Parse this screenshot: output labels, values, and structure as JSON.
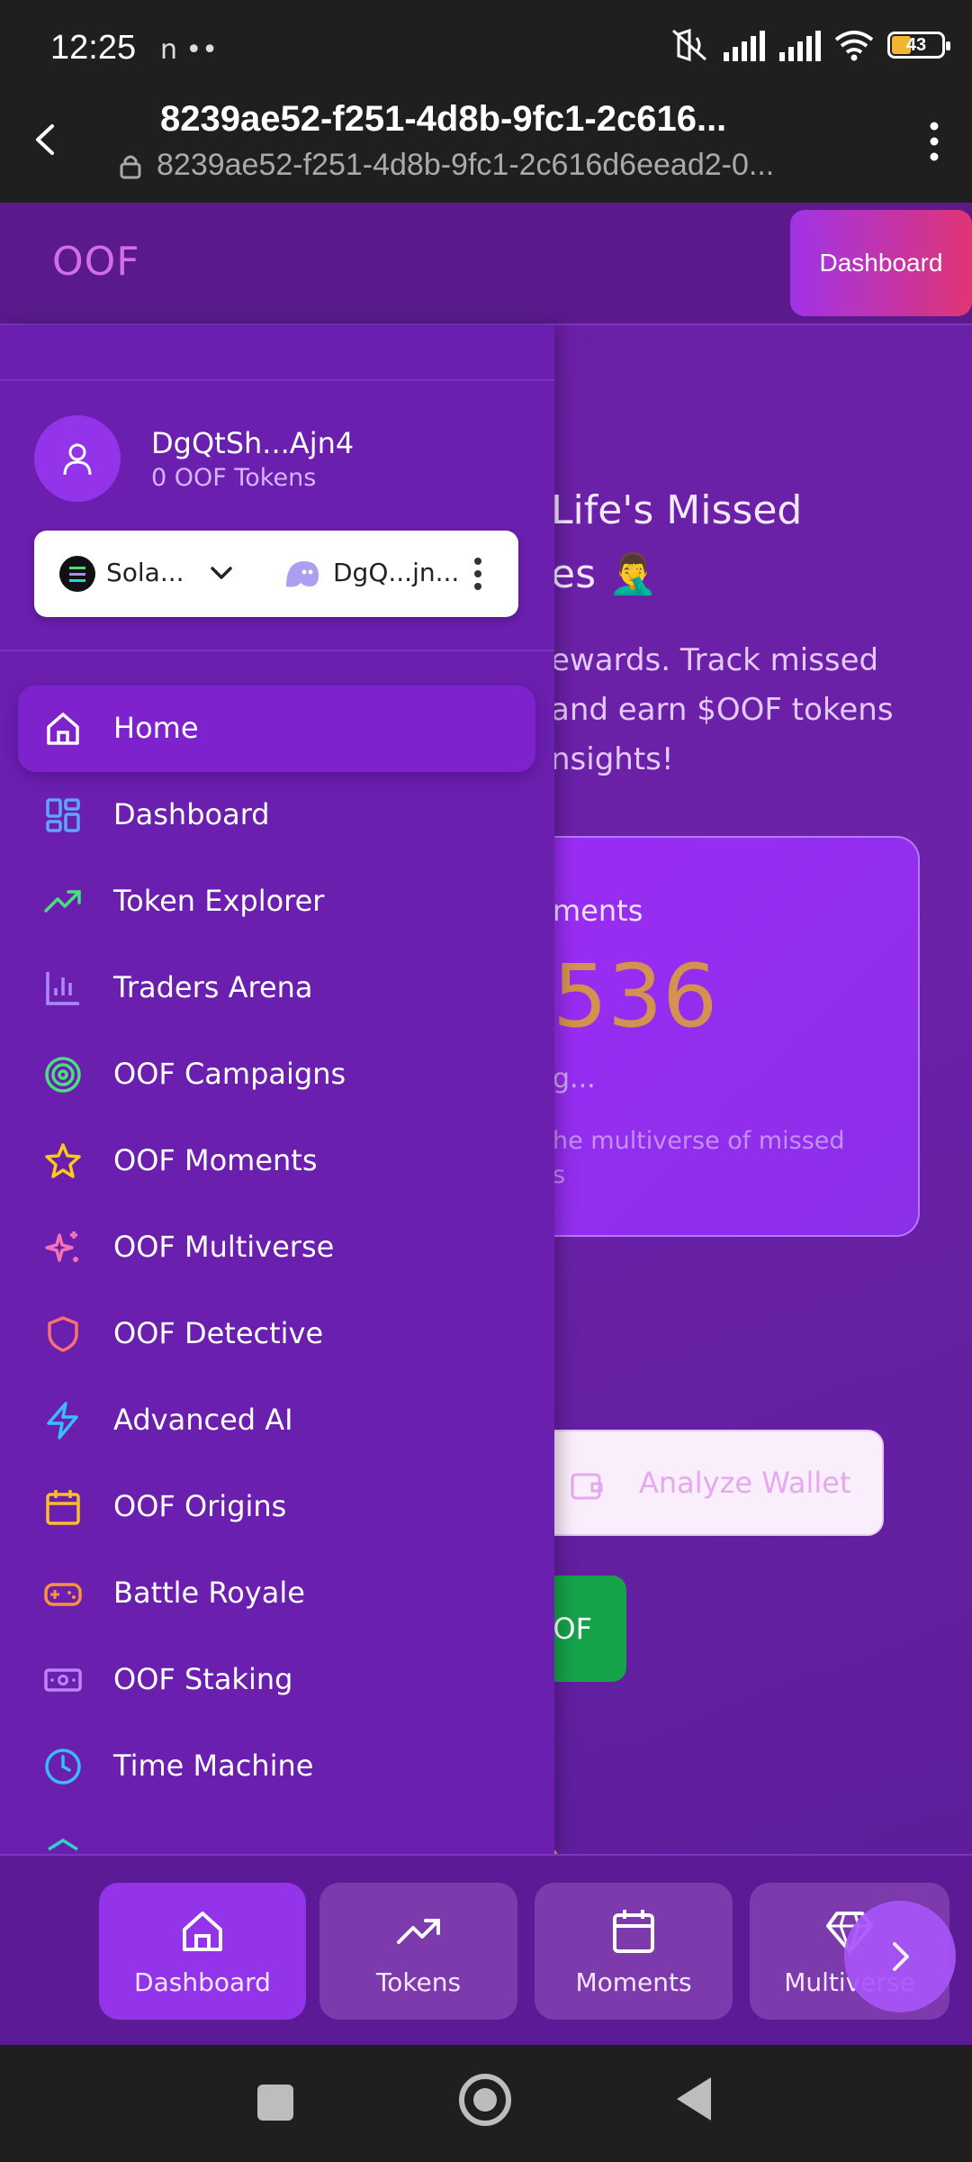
{
  "status_bar": {
    "time": "12:25",
    "notification_icons": "n ••",
    "battery": "43"
  },
  "browser": {
    "title": "8239ae52-f251-4d8b-9fc1-2c616...",
    "url": "8239ae52-f251-4d8b-9fc1-2c616d6eead2-0..."
  },
  "topbar": {
    "logo": "OOF",
    "dashboard_button": "Dashboard"
  },
  "main": {
    "hero_line1": "Life's Missed",
    "hero_line2": "es 🤦‍♂️",
    "hero_sub": [
      "ewards. Track missed",
      "and earn $OOF tokens",
      "nsights!"
    ],
    "stat_label": "ments",
    "stat_value": "536",
    "stat_loading": "g...",
    "stat_desc": [
      "he multiverse of missed",
      "s"
    ],
    "analyze_button": "Analyze Wallet",
    "green_button": "OF"
  },
  "drawer": {
    "user_name": "DgQtSh...Ajn4",
    "user_tokens": "0 OOF Tokens",
    "network": "Sola...",
    "wallet_address": "DgQ...jn...",
    "items": [
      {
        "label": "Home",
        "icon": "home-icon",
        "color": "#ffffff"
      },
      {
        "label": "Dashboard",
        "icon": "grid-icon",
        "color": "#60a5fa"
      },
      {
        "label": "Token Explorer",
        "icon": "trending-up-icon",
        "color": "#4ade80"
      },
      {
        "label": "Traders Arena",
        "icon": "bar-chart-icon",
        "color": "#a78bfa"
      },
      {
        "label": "OOF Campaigns",
        "icon": "target-icon",
        "color": "#4ade80"
      },
      {
        "label": "OOF Moments",
        "icon": "star-icon",
        "color": "#facc15"
      },
      {
        "label": "OOF Multiverse",
        "icon": "sparkles-icon",
        "color": "#f472b6"
      },
      {
        "label": "OOF Detective",
        "icon": "shield-icon",
        "color": "#f87171"
      },
      {
        "label": "Advanced AI",
        "icon": "zap-icon",
        "color": "#38bdf8"
      },
      {
        "label": "OOF Origins",
        "icon": "calendar-icon",
        "color": "#fbbf24"
      },
      {
        "label": "Battle Royale",
        "icon": "gamepad-icon",
        "color": "#fb923c"
      },
      {
        "label": "OOF Staking",
        "icon": "banknote-icon",
        "color": "#c084fc"
      },
      {
        "label": "Time Machine",
        "icon": "clock-icon",
        "color": "#38bdf8"
      }
    ]
  },
  "bottom_nav": {
    "items": [
      {
        "label": "Dashboard",
        "icon": "home-icon"
      },
      {
        "label": "Tokens",
        "icon": "trending-up-icon"
      },
      {
        "label": "Moments",
        "icon": "calendar-icon"
      },
      {
        "label": "Multiverse",
        "icon": "gem-icon"
      }
    ]
  }
}
